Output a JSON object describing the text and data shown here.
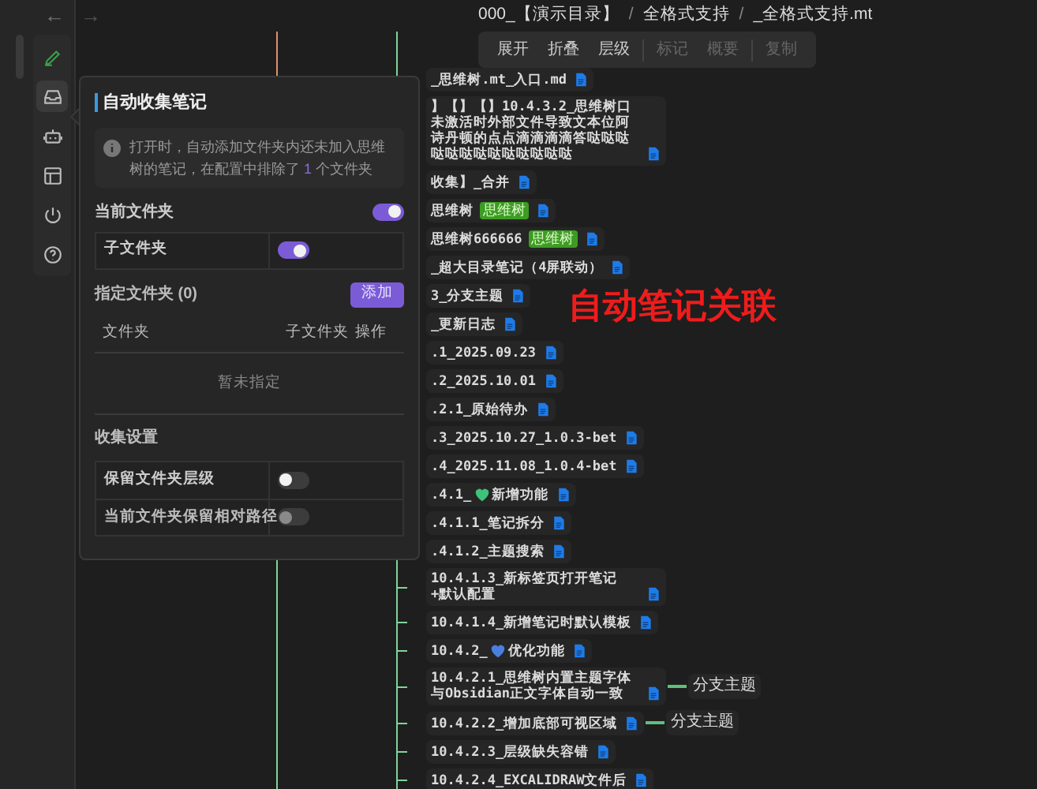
{
  "nav": {
    "back": "←",
    "forward": "→"
  },
  "breadcrumb": [
    {
      "kind": "item",
      "text": "000_【演示目录】"
    },
    {
      "kind": "separator",
      "text": "/"
    },
    {
      "kind": "item",
      "text": "全格式支持"
    },
    {
      "kind": "separator",
      "text": "/"
    },
    {
      "kind": "item",
      "text": "_全格式支持.mt"
    }
  ],
  "sidebar_icons": [
    {
      "kind": "pen",
      "selected": false
    },
    {
      "kind": "inbox",
      "selected": true
    },
    {
      "kind": "bot",
      "selected": false
    },
    {
      "kind": "layout",
      "selected": false
    },
    {
      "kind": "power",
      "selected": false
    },
    {
      "kind": "help",
      "selected": false
    }
  ],
  "toolbar_groups": [
    [
      {
        "label": "展开",
        "disabled": false
      },
      {
        "label": "折叠",
        "disabled": false
      },
      {
        "label": "层级",
        "disabled": false
      }
    ],
    [
      {
        "label": "标记",
        "disabled": true
      },
      {
        "label": "概要",
        "disabled": true
      }
    ],
    [
      {
        "label": "复制",
        "disabled": true
      }
    ]
  ],
  "panel": {
    "title": "自动收集笔记",
    "info": {
      "before": "打开时，自动添加文件夹内还未加入思维树的笔记，在配置中排除了 ",
      "count": "1",
      "after": " 个文件夹"
    },
    "current_folder": {
      "label": "当前文件夹",
      "on": true
    },
    "subfolder": {
      "label": "子文件夹",
      "on": true
    },
    "specified": {
      "label": "指定文件夹 (0)",
      "button": "添加",
      "columns": [
        "文件夹",
        "子文件夹",
        "操作"
      ],
      "empty": "暂未指定"
    },
    "collect_title": "收集设置",
    "collect_settings": [
      {
        "label": "保留文件夹层级",
        "on": false,
        "disabled": false
      },
      {
        "label": "当前文件夹保留相对路径",
        "on": false,
        "disabled": true
      }
    ]
  },
  "overlay_title": "自动笔记关联",
  "nodes": [
    {
      "text": "_思维树.mt_入口.md"
    },
    {
      "text": "】【】【】10.4.3.2_思维树口未激活时外部文件导致文本位阿诗丹顿的点点滴滴滴滴答哒哒哒哒哒哒哒哒哒哒哒哒哒"
    },
    {
      "text": "收集】_合并"
    },
    {
      "text": "思维树",
      "tag": "思维树"
    },
    {
      "text": "思维树666666",
      "tag": "思维树"
    },
    {
      "text": "_超大目录笔记（4屏联动）"
    },
    {
      "text": "3_分支主题"
    },
    {
      "text": "_更新日志"
    },
    {
      "text": ".1_2025.09.23"
    },
    {
      "text": ".2_2025.10.01"
    },
    {
      "text": ".2.1_原始待办"
    },
    {
      "text": ".3_2025.10.27_1.0.3-bet"
    },
    {
      "text": ".4_2025.11.08_1.0.4-bet"
    },
    {
      "text": ".4.1_",
      "color": "#3ec27a",
      "text_after": "新增功能"
    },
    {
      "text": ".4.1.1_笔记拆分"
    },
    {
      "text": ".4.1.2_主题搜索"
    },
    {
      "text": "10.4.1.3_新标签页打开笔记+默认配置"
    },
    {
      "text": "10.4.1.4_新增笔记时默认模板"
    },
    {
      "text": "10.4.2_",
      "color": "#4a7fe0",
      "text_after": "优化功能"
    },
    {
      "text": "10.4.2.1_思维树内置主题字体与Obsidian正文字体自动一致",
      "branch": "分支主题"
    },
    {
      "text": "10.4.2.2_增加底部可视区域",
      "branch": "分支主题"
    },
    {
      "text": "10.4.2.3_层级缺失容错"
    },
    {
      "text": "10.4.2.4_EXCALIDRAW文件后"
    }
  ]
}
